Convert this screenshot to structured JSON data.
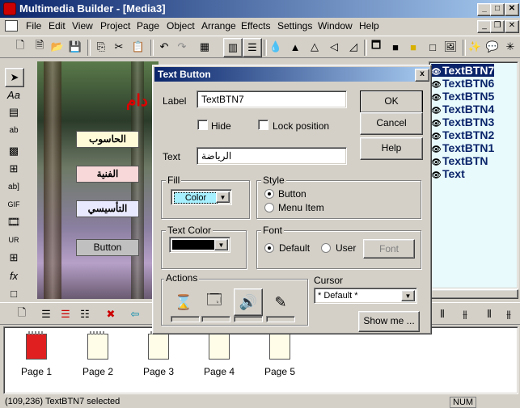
{
  "app": {
    "title": "Multimedia Builder - [Media3]"
  },
  "menu": [
    "File",
    "Edit",
    "View",
    "Project",
    "Page",
    "Object",
    "Arrange",
    "Effects",
    "Settings",
    "Window",
    "Help"
  ],
  "objects": [
    "TextBTN7",
    "TextBTN6",
    "TextBTN5",
    "TextBTN4",
    "TextBTN3",
    "TextBTN2",
    "TextBTN1",
    "TextBTN",
    "Text"
  ],
  "canvas": {
    "buttons": [
      "الحاسوب",
      "الفنية",
      "التأسيسي",
      "Button"
    ],
    "red_text": "دام"
  },
  "pages": [
    "Page 1",
    "Page 2",
    "Page 3",
    "Page 4",
    "Page 5"
  ],
  "status": {
    "text": "(109,236)  TextBTN7 selected",
    "num": "NUM"
  },
  "dialog": {
    "title": "Text Button",
    "label_caption": "Label",
    "label_value": "TextBTN7",
    "hide": "Hide",
    "lock": "Lock position",
    "text_caption": "Text",
    "text_value": "الرياضة",
    "ok": "OK",
    "cancel": "Cancel",
    "help": "Help",
    "fill_title": "Fill",
    "fill_value": "Color",
    "style_title": "Style",
    "style_button": "Button",
    "style_menu": "Menu Item",
    "textcolor_title": "Text Color",
    "font_title": "Font",
    "font_default": "Default",
    "font_user": "User",
    "font_button": "Font",
    "actions_title": "Actions",
    "cursor_title": "Cursor",
    "cursor_value": "* Default *",
    "showme": "Show me ...",
    "close": "x"
  }
}
